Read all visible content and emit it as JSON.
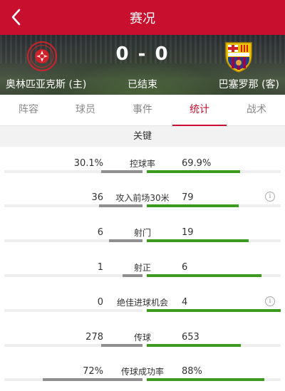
{
  "nav": {
    "title": "赛况",
    "back_icon": "chevron-left-icon"
  },
  "match": {
    "score": "0 - 0",
    "status": "已结束",
    "home_team": "奥林匹亚克斯 (主)",
    "away_team": "巴塞罗那 (客)",
    "home_logo": "olympiacos-crest-icon",
    "away_logo": "barcelona-crest-icon"
  },
  "tabs": [
    {
      "label": "阵容",
      "active": false
    },
    {
      "label": "球员",
      "active": false
    },
    {
      "label": "事件",
      "active": false
    },
    {
      "label": "统计",
      "active": true
    },
    {
      "label": "战术",
      "active": false
    }
  ],
  "section_title": "关键",
  "colors": {
    "accent": "#c8102e",
    "home_bar": "#8f8f8f",
    "away_bar": "#3c9a1e"
  },
  "stats": [
    {
      "label": "控球率",
      "home": "30.1%",
      "away": "69.9%",
      "home_frac": 0.301,
      "away_frac": 0.699,
      "info": false
    },
    {
      "label": "攻入前场30米",
      "home": "36",
      "away": "79",
      "home_frac": 0.313,
      "away_frac": 0.687,
      "info": true
    },
    {
      "label": "射门",
      "home": "6",
      "away": "19",
      "home_frac": 0.24,
      "away_frac": 0.76,
      "info": false
    },
    {
      "label": "射正",
      "home": "1",
      "away": "6",
      "home_frac": 0.143,
      "away_frac": 0.857,
      "info": false
    },
    {
      "label": "绝佳进球机会",
      "home": "0",
      "away": "4",
      "home_frac": 0.0,
      "away_frac": 1.0,
      "info": true
    },
    {
      "label": "传球",
      "home": "278",
      "away": "653",
      "home_frac": 0.299,
      "away_frac": 0.701,
      "info": false
    },
    {
      "label": "传球成功率",
      "home": "72%",
      "away": "88%",
      "home_frac": 0.72,
      "away_frac": 0.88,
      "info": false
    }
  ]
}
